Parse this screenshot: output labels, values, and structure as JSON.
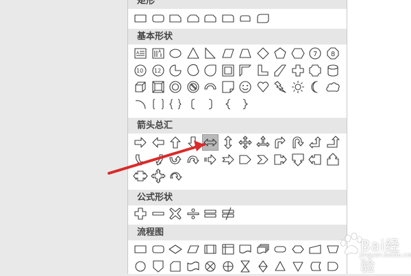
{
  "panel": {
    "categories": [
      {
        "title": "矩形",
        "shapes": [
          "rect",
          "round-rect",
          "snip1",
          "snip2",
          "snip-round",
          "round1",
          "round2",
          "round-diag"
        ]
      },
      {
        "title": "基本形状",
        "shapes": [
          "text-box",
          "vertical-text-box",
          "ellipse",
          "triangle",
          "right-triangle",
          "parallelogram",
          "trapezoid",
          "diamond",
          "pentagon",
          "hexagon",
          "heptagon",
          "octagon",
          "decagon",
          "dodecagon",
          "pie",
          "chord",
          "teardrop",
          "frame",
          "half-frame",
          "l-shape",
          "diagonal-stripe",
          "cross",
          "plaque",
          "can",
          "cube",
          "bevel",
          "donut",
          "no-symbol",
          "block-arc",
          "folded-corner",
          "smiley",
          "heart",
          "lightning",
          "sun",
          "moon",
          "cloud",
          "arc",
          "double-bracket",
          "double-brace",
          "left-bracket",
          "right-bracket",
          "left-brace",
          "right-brace"
        ]
      },
      {
        "title": "箭头总汇",
        "shapes": [
          "right-arrow",
          "left-arrow",
          "up-arrow",
          "down-arrow",
          "left-right-arrow",
          "up-down-arrow",
          "quad-arrow",
          "left-right-up-arrow",
          "bent-arrow",
          "u-turn-arrow",
          "left-up-arrow",
          "bent-up-arrow",
          "curved-right-arrow",
          "curved-left-arrow",
          "curved-up-arrow",
          "curved-down-arrow",
          "striped-right-arrow",
          "notched-right-arrow",
          "pentagon-arrow",
          "chevron",
          "right-arrow-callout",
          "down-arrow-callout",
          "left-arrow-callout",
          "up-arrow-callout",
          "left-right-arrow-callout",
          "quad-arrow-callout",
          "circular-arrow"
        ]
      },
      {
        "title": "公式形状",
        "shapes": [
          "math-plus",
          "math-minus",
          "math-multiply",
          "math-divide",
          "math-equal",
          "math-not-equal"
        ]
      },
      {
        "title": "流程图",
        "shapes": [
          "flow-process",
          "flow-alt-process",
          "flow-decision",
          "flow-data",
          "flow-predefined",
          "flow-internal-storage",
          "flow-document",
          "flow-multidocument",
          "flow-terminator",
          "flow-preparation",
          "flow-manual-input",
          "flow-manual-operation",
          "flow-connector",
          "flow-offpage",
          "flow-card",
          "flow-punched-tape",
          "flow-summing",
          "flow-or",
          "flow-collate",
          "flow-sort",
          "flow-extract",
          "flow-merge",
          "flow-stored-data",
          "flow-delay"
        ]
      }
    ],
    "selected_shape": "left-right-arrow"
  },
  "watermark": {
    "brand": "Bai经验",
    "sub": "jingyan.baidu.com"
  },
  "colors": {
    "pointer_arrow": "#d92b2b",
    "header_bg": "#e6e6e6",
    "selected_bg": "#b9b9b9"
  }
}
